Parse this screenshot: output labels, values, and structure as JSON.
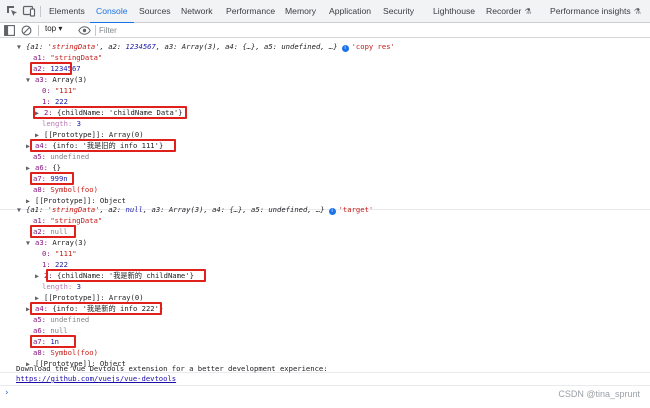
{
  "tabs": [
    {
      "label": "Elements"
    },
    {
      "label": "Console"
    },
    {
      "label": "Sources"
    },
    {
      "label": "Network"
    },
    {
      "label": "Performance"
    },
    {
      "label": "Memory"
    },
    {
      "label": "Application"
    },
    {
      "label": "Security"
    },
    {
      "label": "Lighthouse"
    },
    {
      "label": "Recorder"
    },
    {
      "label": "Performance insights"
    }
  ],
  "active_tab": "Console",
  "toolbar": {
    "context": "top ▾",
    "filter_placeholder": "Filter"
  },
  "log1": {
    "summary_pre": "{a1: ",
    "summary_a1": "'stringData'",
    "summary_mid1": ", a2: ",
    "summary_a2": "1234567",
    "summary_rest": ", a3: Array(3), a4: {…}, a5: undefined, …}",
    "label": "'copy res'",
    "a1_key": "a1:",
    "a1_val": "\"stringData\"",
    "a2_key": "a2:",
    "a2_val": "1234567",
    "a3_key": "a3:",
    "a3_val": "Array(3)",
    "a3_0_key": "0:",
    "a3_0_val": "\"111\"",
    "a3_1_key": "1:",
    "a3_1_val": "222",
    "a3_2_key": "2:",
    "a3_2_val": "{childName: 'childName Data'}",
    "a3_len_key": "length:",
    "a3_len_val": "3",
    "a3_proto": "[[Prototype]]: Array(0)",
    "a4_key": "a4:",
    "a4_val": "{info: '我是旧的 info 111'}",
    "a5_key": "a5:",
    "a5_val": "undefined",
    "a6_key": "a6:",
    "a6_val": "{}",
    "a7_key": "a7:",
    "a7_val": "999n",
    "a8_key": "a8:",
    "a8_val": "Symbol(foo)",
    "proto": "[[Prototype]]: Object"
  },
  "log2": {
    "summary_pre": "{a1: ",
    "summary_a1": "'stringData'",
    "summary_mid1": ", a2: ",
    "summary_a2": "null",
    "summary_rest": ", a3: Array(3), a4: {…}, a5: undefined, …}",
    "label": "'target'",
    "a1_key": "a1:",
    "a1_val": "\"stringData\"",
    "a2_key": "a2:",
    "a2_val": "null",
    "a3_key": "a3:",
    "a3_val": "Array(3)",
    "a3_0_key": "0:",
    "a3_0_val": "\"111\"",
    "a3_1_key": "1:",
    "a3_1_val": "222",
    "a3_2_key": "2:",
    "a3_2_val": "{childName: '我是新的 childName'}",
    "a3_len_key": "length:",
    "a3_len_val": "3",
    "a3_proto": "[[Prototype]]: Array(0)",
    "a4_key": "a4:",
    "a4_val": "{info: '我是新的 info 222'}",
    "a5_key": "a5:",
    "a5_val": "undefined",
    "a6_key": "a6:",
    "a6_val": "null",
    "a7_key": "a7:",
    "a7_val": "1n",
    "a8_key": "a8:",
    "a8_val": "Symbol(foo)",
    "proto": "[[Prototype]]: Object"
  },
  "footer": {
    "message": "Download the Vue Devtools extension for a better development experience:",
    "link": "https://github.com/vuejs/vue-devtools",
    "prompt": "›"
  },
  "watermark": "CSDN @tina_sprunt",
  "colors": {
    "accent": "#1a73e8",
    "highlight": "#e0201a",
    "key": "#881280",
    "string": "#c41a16",
    "number": "#1a1aa6"
  }
}
